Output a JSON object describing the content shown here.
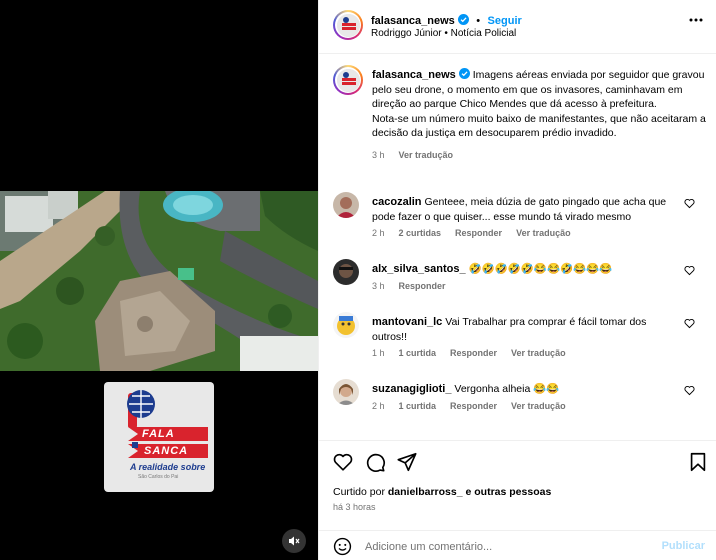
{
  "post": {
    "username": "falasanca_news",
    "follow_label": "Seguir",
    "subtitle": "Rodriggo Júnior • Notícia Policial",
    "caption_username": "falasanca_news",
    "caption_text": "Imagens aéreas enviada por seguidor que gravou pelo seu drone, o momento em que os invasores, caminhavam em direção ao parque Chico Mendes que dá acesso à prefeitura.\nNota-se um número muito baixo de manifestantes, que não aceitaram a decisão da justiça em desocuparem prédio invadido.",
    "caption_time": "3 h",
    "caption_translate": "Ver tradução"
  },
  "media": {
    "logo_line1": "FALA",
    "logo_line2": "SANCA",
    "logo_tagline": "A realidade sobre",
    "logo_small": "São Carlos do Pai"
  },
  "comments": [
    {
      "username": "cacozalin",
      "text": "Genteee, meia dúzia de gato pingado que acha que pode fazer o que quiser... esse mundo tá virado mesmo",
      "time": "2 h",
      "likes": "2 curtidas",
      "reply": "Responder",
      "translate": "Ver tradução"
    },
    {
      "username": "alx_silva_santos_",
      "text": "🤣🤣🤣🤣🤣😂😂🤣😂😂😂",
      "time": "3 h",
      "likes": "",
      "reply": "Responder",
      "translate": ""
    },
    {
      "username": "mantovani_lc",
      "text": "Vai Trabalhar pra comprar é fácil tomar dos outros!!",
      "time": "1 h",
      "likes": "1 curtida",
      "reply": "Responder",
      "translate": "Ver tradução"
    },
    {
      "username": "suzanagiglioti_",
      "text": "Vergonha alheia 😂😂",
      "time": "2 h",
      "likes": "1 curtida",
      "reply": "Responder",
      "translate": "Ver tradução"
    }
  ],
  "footer": {
    "liked_prefix": "Curtido por",
    "liked_user": "danielbarross_",
    "liked_suffix": "e outras pessoas",
    "time_ago": "há 3 horas",
    "comment_placeholder": "Adicione um comentário...",
    "publish_label": "Publicar"
  },
  "colors": {
    "accent": "#0095f6",
    "logo_red": "#d9232d",
    "logo_blue": "#1d3c8f"
  },
  "icons": [
    "more-options-icon",
    "verified-icon",
    "heart-icon",
    "comment-icon",
    "share-icon",
    "bookmark-icon",
    "emoji-icon",
    "mute-icon"
  ]
}
